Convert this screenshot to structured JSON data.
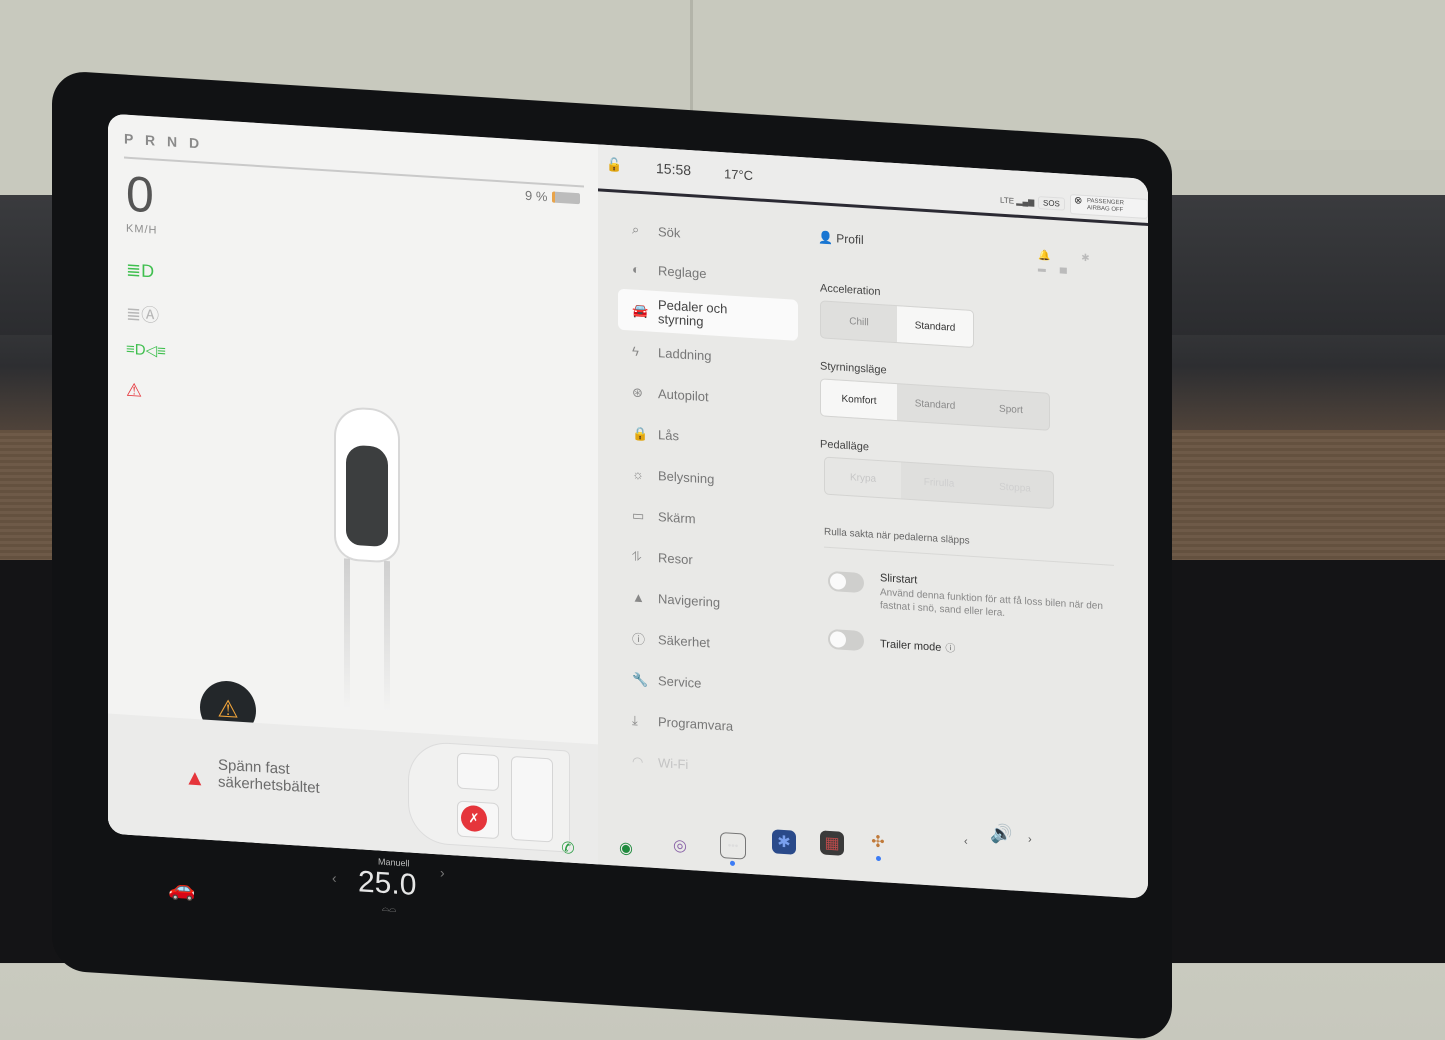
{
  "drive": {
    "gear_selector": "P R N D",
    "speed": "0",
    "speed_unit": "KM/H",
    "battery_percent": "9 %",
    "battery_level": 0.09,
    "telltales": [
      {
        "icon": "low-beam-icon",
        "glyph": "≣D",
        "color": "#3fbf4f"
      },
      {
        "icon": "auto-high-beam-icon",
        "glyph": "≣Ⓐ",
        "color": "#b7b7b7"
      },
      {
        "icon": "parking-lights-icon",
        "glyph": "≡D◁≡",
        "color": "#3fbf4f"
      },
      {
        "icon": "seatbelt-warning-icon",
        "glyph": "⚠",
        "color": "#e5353b"
      }
    ],
    "hazard_glyph": "⚠",
    "alert": {
      "icon_glyph": "▲",
      "message": "Spänn fast säkerhetsbältet",
      "seat_alert_glyph": "✗"
    }
  },
  "status_bar": {
    "lock_glyph": "🔓",
    "time": "15:58",
    "temperature": "17°C",
    "lte": "LTE ▂▄▆",
    "sos": "SOS",
    "airbag_label": "PASSENGER AIRBAG OFF"
  },
  "profile": {
    "label": "Profil",
    "glyph": "👤"
  },
  "mini_status": "🔔 ✱ ▂▄",
  "nav": {
    "search": {
      "label": "Sök",
      "glyph": "⌕"
    },
    "items": [
      {
        "label": "Reglage",
        "glyph": "◐"
      },
      {
        "label": "Pedaler och styrning",
        "glyph": "🚘",
        "active": true
      },
      {
        "label": "Laddning",
        "glyph": "ϟ"
      },
      {
        "label": "Autopilot",
        "glyph": "⊛"
      },
      {
        "label": "Lås",
        "glyph": "🔒"
      },
      {
        "label": "Belysning",
        "glyph": "☼"
      },
      {
        "label": "Skärm",
        "glyph": "▭"
      },
      {
        "label": "Resor",
        "glyph": "⥮"
      },
      {
        "label": "Navigering",
        "glyph": "▲"
      },
      {
        "label": "Säkerhet",
        "glyph": "ⓘ"
      },
      {
        "label": "Service",
        "glyph": "🔧"
      },
      {
        "label": "Programvara",
        "glyph": "⤓"
      },
      {
        "label": "Wi-Fi",
        "glyph": "◠",
        "faded": true
      }
    ]
  },
  "acceleration": {
    "label": "Acceleration",
    "options": [
      "Chill",
      "Standard"
    ],
    "selected": "Standard"
  },
  "steering": {
    "label": "Styrningsläge",
    "options": [
      "Komfort",
      "Standard",
      "Sport"
    ],
    "selected": "Komfort"
  },
  "pedal": {
    "label": "Pedalläge",
    "options": [
      "Krypa",
      "Frirulla",
      "Stoppa"
    ],
    "selected": "Krypa",
    "disabled": true,
    "hint": "Rulla sakta när pedalerna släpps"
  },
  "toggles": [
    {
      "title": "Slirstart",
      "description": "Använd denna funktion för att få loss bilen när den fastnat i snö, sand eller lera.",
      "on": false
    },
    {
      "title": "Trailer mode",
      "info_glyph": "ⓘ",
      "on": false
    }
  ],
  "taskbar": {
    "car_glyph": "🚗",
    "climate_mode": "Manuell",
    "climate_temp": "25.0",
    "climate_left": "‹",
    "climate_right": "›",
    "climate_sub": "⌓⌓",
    "apps": [
      {
        "name": "phone",
        "glyph": "✆",
        "color": "#2e9e46"
      },
      {
        "name": "spotify",
        "glyph": "◉",
        "color": "#1e8a3c"
      },
      {
        "name": "camera",
        "glyph": "◎",
        "color": "#8a63a8"
      },
      {
        "name": "more",
        "glyph": "•••",
        "color": "#dddddd",
        "dot": true
      },
      {
        "name": "bluetooth",
        "glyph": "✱",
        "color": "#3d6fd6"
      },
      {
        "name": "calendar",
        "glyph": "▦",
        "color": "#b84a4a"
      },
      {
        "name": "games",
        "glyph": "✣",
        "color": "#c07a3a",
        "dot": true
      }
    ],
    "volume_glyph": "🔊",
    "volume_left": "‹",
    "volume_right": "›"
  }
}
